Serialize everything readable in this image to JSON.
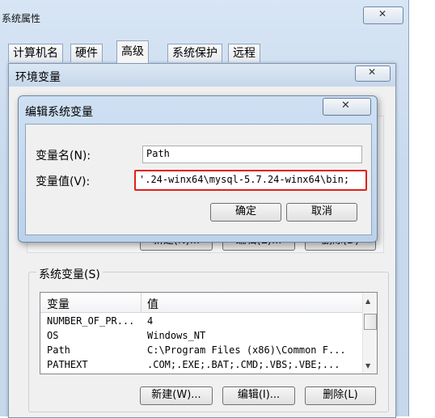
{
  "system_properties": {
    "title": "系统属性",
    "tabs": [
      {
        "label": "计算机名"
      },
      {
        "label": "硬件"
      },
      {
        "label": "高级",
        "active": true
      },
      {
        "label": "系统保护"
      },
      {
        "label": "远程"
      }
    ]
  },
  "env_window": {
    "title": "环境变量",
    "system_vars_group_label": "系统变量(S)",
    "columns": {
      "name": "变量",
      "value": "值"
    },
    "rows": [
      {
        "name": "NUMBER_OF_PR...",
        "value": "4"
      },
      {
        "name": "OS",
        "value": "Windows_NT"
      },
      {
        "name": "Path",
        "value": "C:\\Program Files (x86)\\Common F..."
      },
      {
        "name": "PATHEXT",
        "value": ".COM;.EXE;.BAT;.CMD;.VBS;.VBE;..."
      }
    ],
    "buttons": {
      "new": "新建(W)...",
      "edit": "编辑(I)...",
      "delete": "删除(L)"
    },
    "user_buttons": {
      "new": "新建(N)...",
      "edit": "编辑(E)...",
      "delete": "删除(D)"
    }
  },
  "edit_dialog": {
    "title": "编辑系统变量",
    "name_label": "变量名(N):",
    "name_value": "Path",
    "value_label": "变量值(V):",
    "value_text": "'.24-winx64\\mysql-5.7.24-winx64\\bin;",
    "ok_label": "确定",
    "cancel_label": "取消"
  },
  "colors": {
    "highlight": "#e0201a",
    "title_gradient": "#cfe0f3"
  }
}
